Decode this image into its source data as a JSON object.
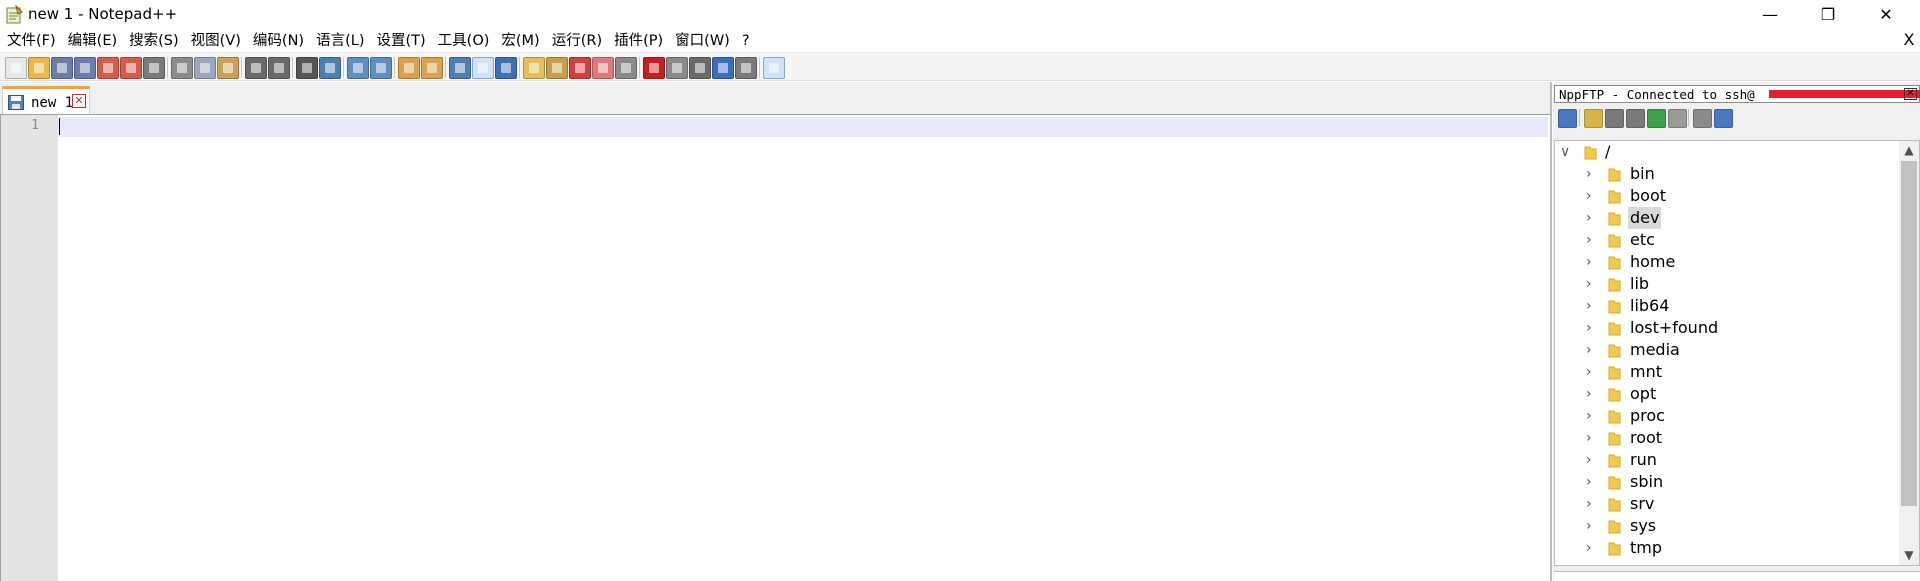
{
  "window": {
    "title": "new 1 - Notepad++",
    "controls": {
      "minimize": "—",
      "maximize": "❐",
      "close": "✕"
    }
  },
  "menu": {
    "items": [
      "文件(F)",
      "编辑(E)",
      "搜索(S)",
      "视图(V)",
      "编码(N)",
      "语言(L)",
      "设置(T)",
      "工具(O)",
      "宏(M)",
      "运行(R)",
      "插件(P)",
      "窗口(W)",
      "?"
    ],
    "close_glyph": "X"
  },
  "toolbar": {
    "buttons": [
      {
        "icon": "new-file-icon",
        "color": "#e9e9e9"
      },
      {
        "icon": "open-file-icon",
        "color": "#e8b84a"
      },
      {
        "icon": "save-icon",
        "color": "#6a7fa8"
      },
      {
        "icon": "save-all-icon",
        "color": "#6a7fa8"
      },
      {
        "icon": "close-icon",
        "color": "#d65b4c"
      },
      {
        "icon": "close-all-icon",
        "color": "#d65b4c"
      },
      {
        "icon": "print-icon",
        "color": "#7a7a7a"
      },
      {
        "icon": "cut-icon",
        "color": "#8c8c8c"
      },
      {
        "icon": "copy-icon",
        "color": "#9aa7bd"
      },
      {
        "icon": "paste-icon",
        "color": "#c9a25a"
      },
      {
        "icon": "undo-icon",
        "color": "#6a6a6a"
      },
      {
        "icon": "redo-icon",
        "color": "#6a6a6a"
      },
      {
        "icon": "find-icon",
        "color": "#555555"
      },
      {
        "icon": "replace-icon",
        "color": "#4f7fb0"
      },
      {
        "icon": "zoom-in-icon",
        "color": "#5d8fbf"
      },
      {
        "icon": "zoom-out-icon",
        "color": "#5d8fbf"
      },
      {
        "icon": "sync-vertical-icon",
        "color": "#d9a24a"
      },
      {
        "icon": "sync-horizontal-icon",
        "color": "#d9a24a"
      },
      {
        "icon": "word-wrap-icon",
        "color": "#4f7fb0"
      },
      {
        "icon": "show-all-chars-icon",
        "color": "#3e6fb0"
      },
      {
        "icon": "indent-guide-icon",
        "color": "#3e6fb0"
      },
      {
        "icon": "language-icon",
        "color": "#e4c05a"
      },
      {
        "icon": "doc-map-icon",
        "color": "#c8a04a"
      },
      {
        "icon": "function-list-icon",
        "color": "#d04040"
      },
      {
        "icon": "folder-workspace-icon",
        "color": "#e07a7a"
      },
      {
        "icon": "monitoring-icon",
        "color": "#8a8a8a"
      },
      {
        "icon": "record-macro-icon",
        "color": "#c81e1e"
      },
      {
        "icon": "stop-record-icon",
        "color": "#8a8a8a"
      },
      {
        "icon": "play-macro-icon",
        "color": "#6a6a6a"
      },
      {
        "icon": "run-macro-multiple-icon",
        "color": "#3a6fc0"
      },
      {
        "icon": "save-macro-icon",
        "color": "#7a7a7a"
      },
      {
        "icon": "nppftp-icon",
        "color": "#c9a23c"
      }
    ]
  },
  "tabs": [
    {
      "label": "new 1",
      "close_glyph": "✕"
    }
  ],
  "editor": {
    "line_numbers": [
      "1"
    ],
    "current_line_color": "#e8e8ff"
  },
  "ftp_panel": {
    "caption": "NppFTP - Connected to ssh@",
    "close_glyph": "✕",
    "toolbar_icons": [
      {
        "icon": "connect-icon",
        "color": "#4a78c0"
      },
      {
        "icon": "open-directory-icon",
        "color": "#d9b24a"
      },
      {
        "icon": "download-icon",
        "color": "#7a7a7a"
      },
      {
        "icon": "upload-icon",
        "color": "#7a7a7a"
      },
      {
        "icon": "refresh-icon",
        "color": "#3fa04a"
      },
      {
        "icon": "abort-icon",
        "color": "#9a9a9a"
      },
      {
        "icon": "settings-icon",
        "color": "#8a8a8a"
      },
      {
        "icon": "message-window-icon",
        "color": "#4a78c0"
      }
    ],
    "tree": {
      "root": "/",
      "items": [
        "bin",
        "boot",
        "dev",
        "etc",
        "home",
        "lib",
        "lib64",
        "lost+found",
        "media",
        "mnt",
        "opt",
        "proc",
        "root",
        "run",
        "sbin",
        "srv",
        "sys",
        "tmp"
      ],
      "selected": "dev",
      "expanded_glyph": "∨",
      "collapsed_glyph": "›"
    }
  },
  "colors": {
    "tab_accent": "#f4a232",
    "folder": "#f2c94c",
    "redaction": "#e81c2a"
  }
}
